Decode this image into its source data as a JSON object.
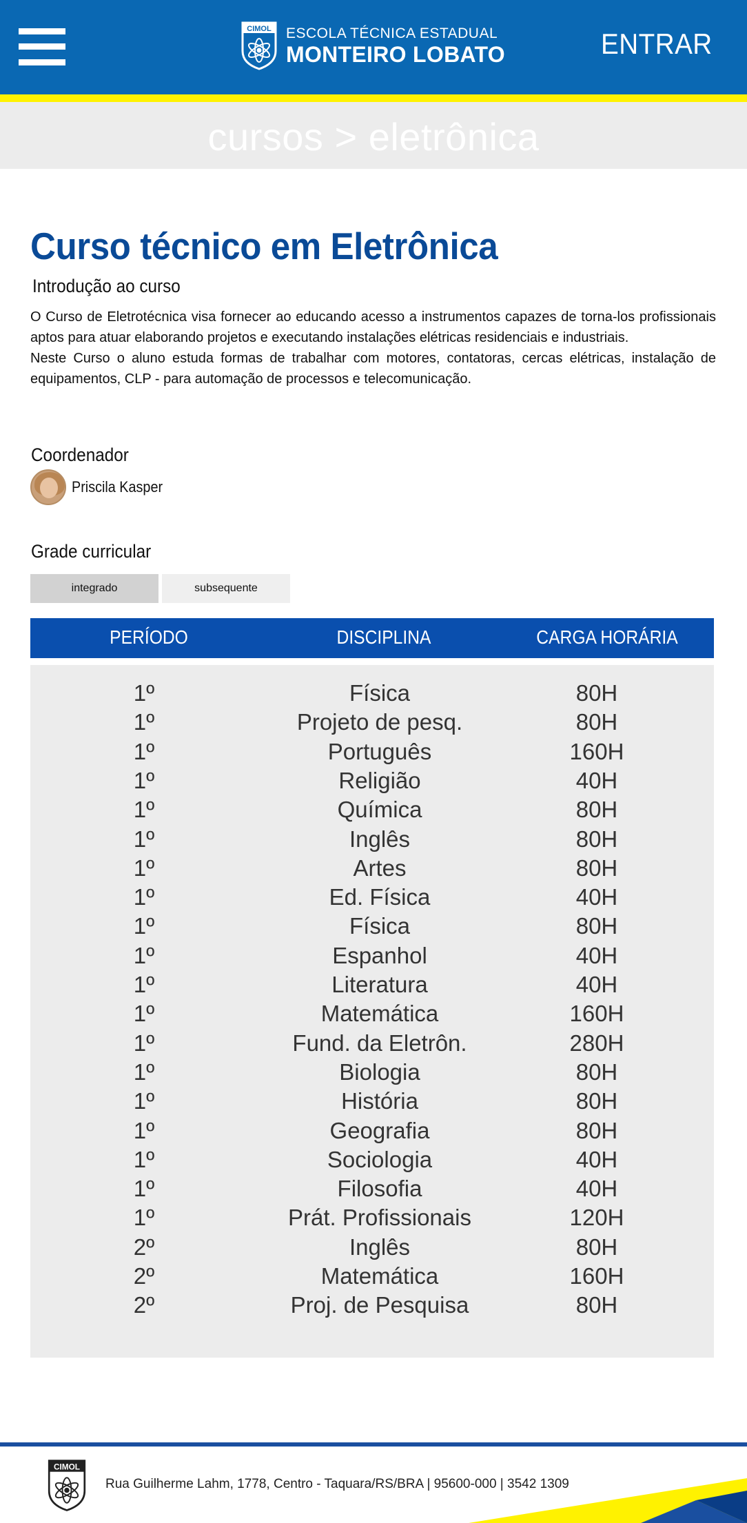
{
  "header": {
    "school_line1": "ESCOLA TÉCNICA ESTADUAL",
    "school_line2": "MONTEIRO LOBATO",
    "logo_badge": "CIMOL",
    "login_label": "ENTRAR",
    "colors": {
      "primary": "#0a68b3",
      "accent": "#fff200"
    }
  },
  "breadcrumb": "cursos > eletrônica",
  "course": {
    "title": "Curso técnico em Eletrônica",
    "intro_heading": "Introdução ao curso",
    "intro_paragraph1": "O Curso de Eletrotécnica visa fornecer ao educando acesso a instrumentos capazes de torna-los profissionais aptos para atuar elaborando projetos e executando instalações elétricas residenciais e industriais.",
    "intro_paragraph2": "Neste Curso o aluno estuda formas de trabalhar com motores, contatoras, cercas elétricas, instalação de equipamentos, CLP - para automação de processos e telecomunicação."
  },
  "coordinator": {
    "heading": "Coordenador",
    "name": "Priscila Kasper"
  },
  "curriculum": {
    "heading": "Grade curricular",
    "tabs": [
      {
        "label": "integrado",
        "active": true
      },
      {
        "label": "subsequente",
        "active": false
      }
    ],
    "columns": [
      "PERÍODO",
      "DISCIPLINA",
      "CARGA HORÁRIA"
    ],
    "rows": [
      {
        "period": "1º",
        "subject": "Física",
        "hours": "80H"
      },
      {
        "period": "1º",
        "subject": "Projeto de pesq.",
        "hours": "80H"
      },
      {
        "period": "1º",
        "subject": "Português",
        "hours": "160H"
      },
      {
        "period": "1º",
        "subject": "Religião",
        "hours": "40H"
      },
      {
        "period": "1º",
        "subject": "Química",
        "hours": "80H"
      },
      {
        "period": "1º",
        "subject": "Inglês",
        "hours": "80H"
      },
      {
        "period": "1º",
        "subject": "Artes",
        "hours": "80H"
      },
      {
        "period": "1º",
        "subject": "Ed. Física",
        "hours": "40H"
      },
      {
        "period": "1º",
        "subject": "Física",
        "hours": "80H"
      },
      {
        "period": "1º",
        "subject": "Espanhol",
        "hours": "40H"
      },
      {
        "period": "1º",
        "subject": "Literatura",
        "hours": "40H"
      },
      {
        "period": "1º",
        "subject": "Matemática",
        "hours": "160H"
      },
      {
        "period": "1º",
        "subject": "Fund. da Eletrôn.",
        "hours": "280H"
      },
      {
        "period": "1º",
        "subject": "Biologia",
        "hours": "80H"
      },
      {
        "period": "1º",
        "subject": "História",
        "hours": "80H"
      },
      {
        "period": "1º",
        "subject": "Geografia",
        "hours": "80H"
      },
      {
        "period": "1º",
        "subject": "Sociologia",
        "hours": "40H"
      },
      {
        "period": "1º",
        "subject": "Filosofia",
        "hours": "40H"
      },
      {
        "period": "1º",
        "subject": "Prát. Profissionais",
        "hours": "120H"
      },
      {
        "period": "2º",
        "subject": "Inglês",
        "hours": "80H"
      },
      {
        "period": "2º",
        "subject": "Matemática",
        "hours": "160H"
      },
      {
        "period": "2º",
        "subject": "Proj. de Pesquisa",
        "hours": "80H"
      }
    ]
  },
  "footer": {
    "logo_badge": "CIMOL",
    "address": "Rua Guilherme Lahm, 1778, Centro - Taquara/RS/BRA | 95600-000 | 3542 1309"
  }
}
